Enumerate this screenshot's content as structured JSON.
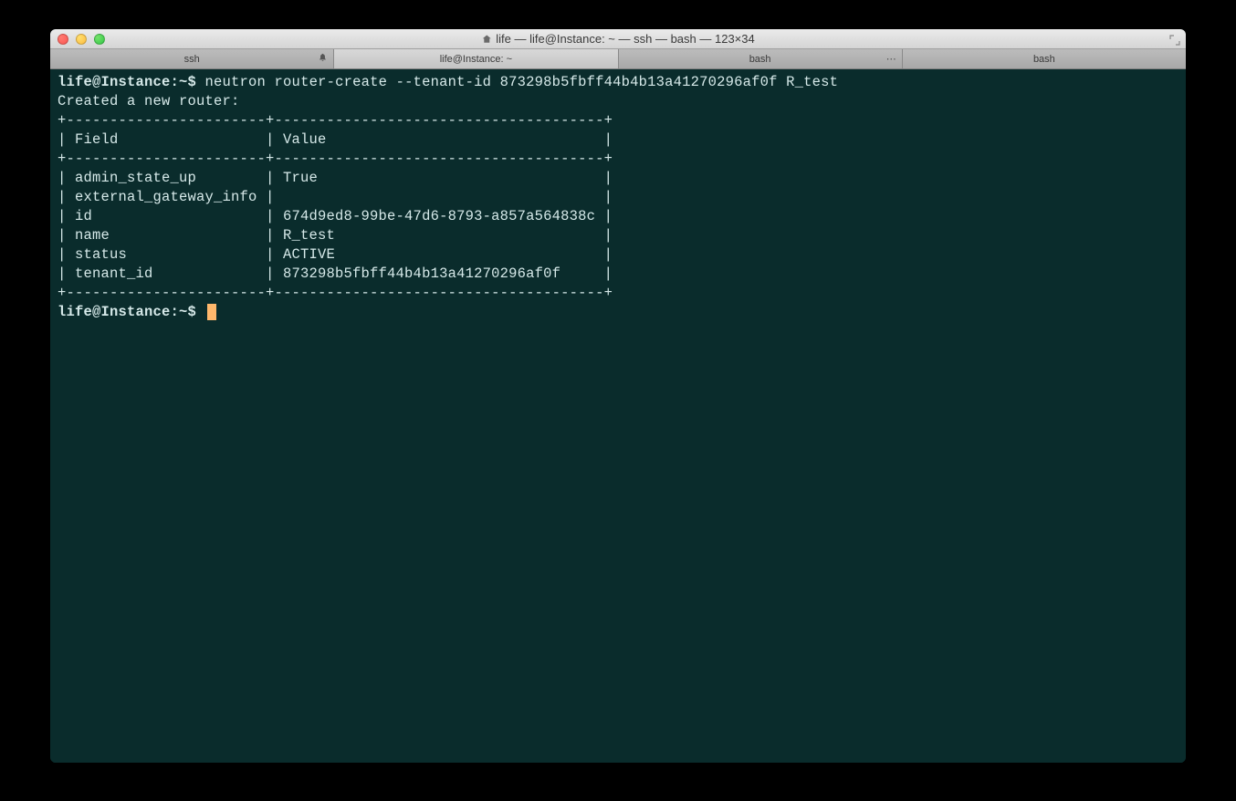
{
  "window": {
    "title": "life — life@Instance: ~ — ssh — bash — 123×34"
  },
  "tabs": [
    {
      "label": "ssh",
      "icon": "bell",
      "active": false
    },
    {
      "label": "life@Instance: ~",
      "icon": "",
      "active": true
    },
    {
      "label": "bash",
      "icon": "ellipsis",
      "active": false
    },
    {
      "label": "bash",
      "icon": "",
      "active": false
    }
  ],
  "terminal": {
    "prompt1": "life@Instance:~$",
    "command": "neutron router-create --tenant-id 873298b5fbff44b4b13a41270296af0f R_test",
    "response_header": "Created a new router:",
    "table": {
      "border_top": "+-----------------------+--------------------------------------+",
      "header": "| Field                 | Value                                |",
      "border_mid": "+-----------------------+--------------------------------------+",
      "rows": [
        "| admin_state_up        | True                                 |",
        "| external_gateway_info |                                      |",
        "| id                    | 674d9ed8-99be-47d6-8793-a857a564838c |",
        "| name                  | R_test                               |",
        "| status                | ACTIVE                               |",
        "| tenant_id             | 873298b5fbff44b4b13a41270296af0f     |"
      ],
      "border_bot": "+-----------------------+--------------------------------------+"
    },
    "prompt2": "life@Instance:~$"
  },
  "table_data": {
    "Field": [
      "admin_state_up",
      "external_gateway_info",
      "id",
      "name",
      "status",
      "tenant_id"
    ],
    "Value": [
      "True",
      "",
      "674d9ed8-99be-47d6-8793-a857a564838c",
      "R_test",
      "ACTIVE",
      "873298b5fbff44b4b13a41270296af0f"
    ]
  }
}
